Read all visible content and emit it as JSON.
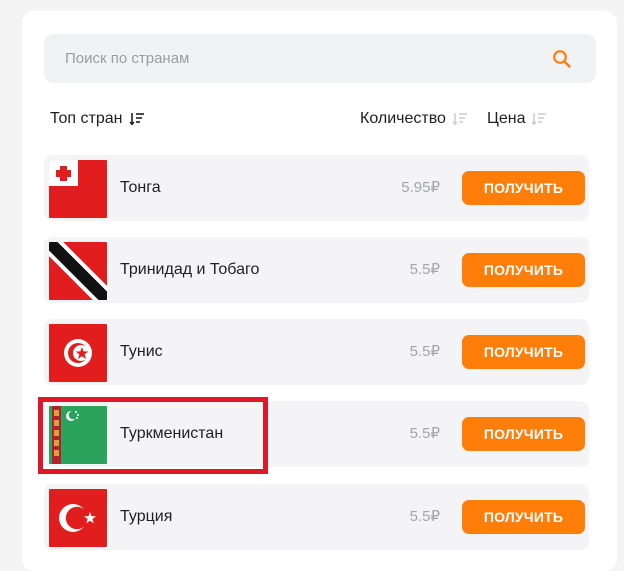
{
  "search": {
    "placeholder": "Поиск по странам",
    "icon": "search-icon"
  },
  "table_header": {
    "countries": "Топ стран",
    "quantity": "Количество",
    "price": "Цена"
  },
  "countries": [
    {
      "name": "Тонга",
      "price": "5.95₽",
      "button": "ПОЛУЧИТЬ",
      "flag": "tonga-flag-icon"
    },
    {
      "name": "Тринидад и Тобаго",
      "price": "5.5₽",
      "button": "ПОЛУЧИТЬ",
      "flag": "trinidad-and-tobago-flag-icon"
    },
    {
      "name": "Тунис",
      "price": "5.5₽",
      "button": "ПОЛУЧИТЬ",
      "flag": "tunisia-flag-icon"
    },
    {
      "name": "Туркменистан",
      "price": "5.5₽",
      "button": "ПОЛУЧИТЬ",
      "flag": "turkmenistan-flag-icon"
    },
    {
      "name": "Турция",
      "price": "5.5₽",
      "button": "ПОЛУЧИТЬ",
      "flag": "turkey-flag-icon"
    }
  ],
  "colors": {
    "accent": "#ff7e0a",
    "highlight": "#e0162b",
    "row_bg": "#f4f4f6",
    "price_text": "#a3a5ab"
  }
}
